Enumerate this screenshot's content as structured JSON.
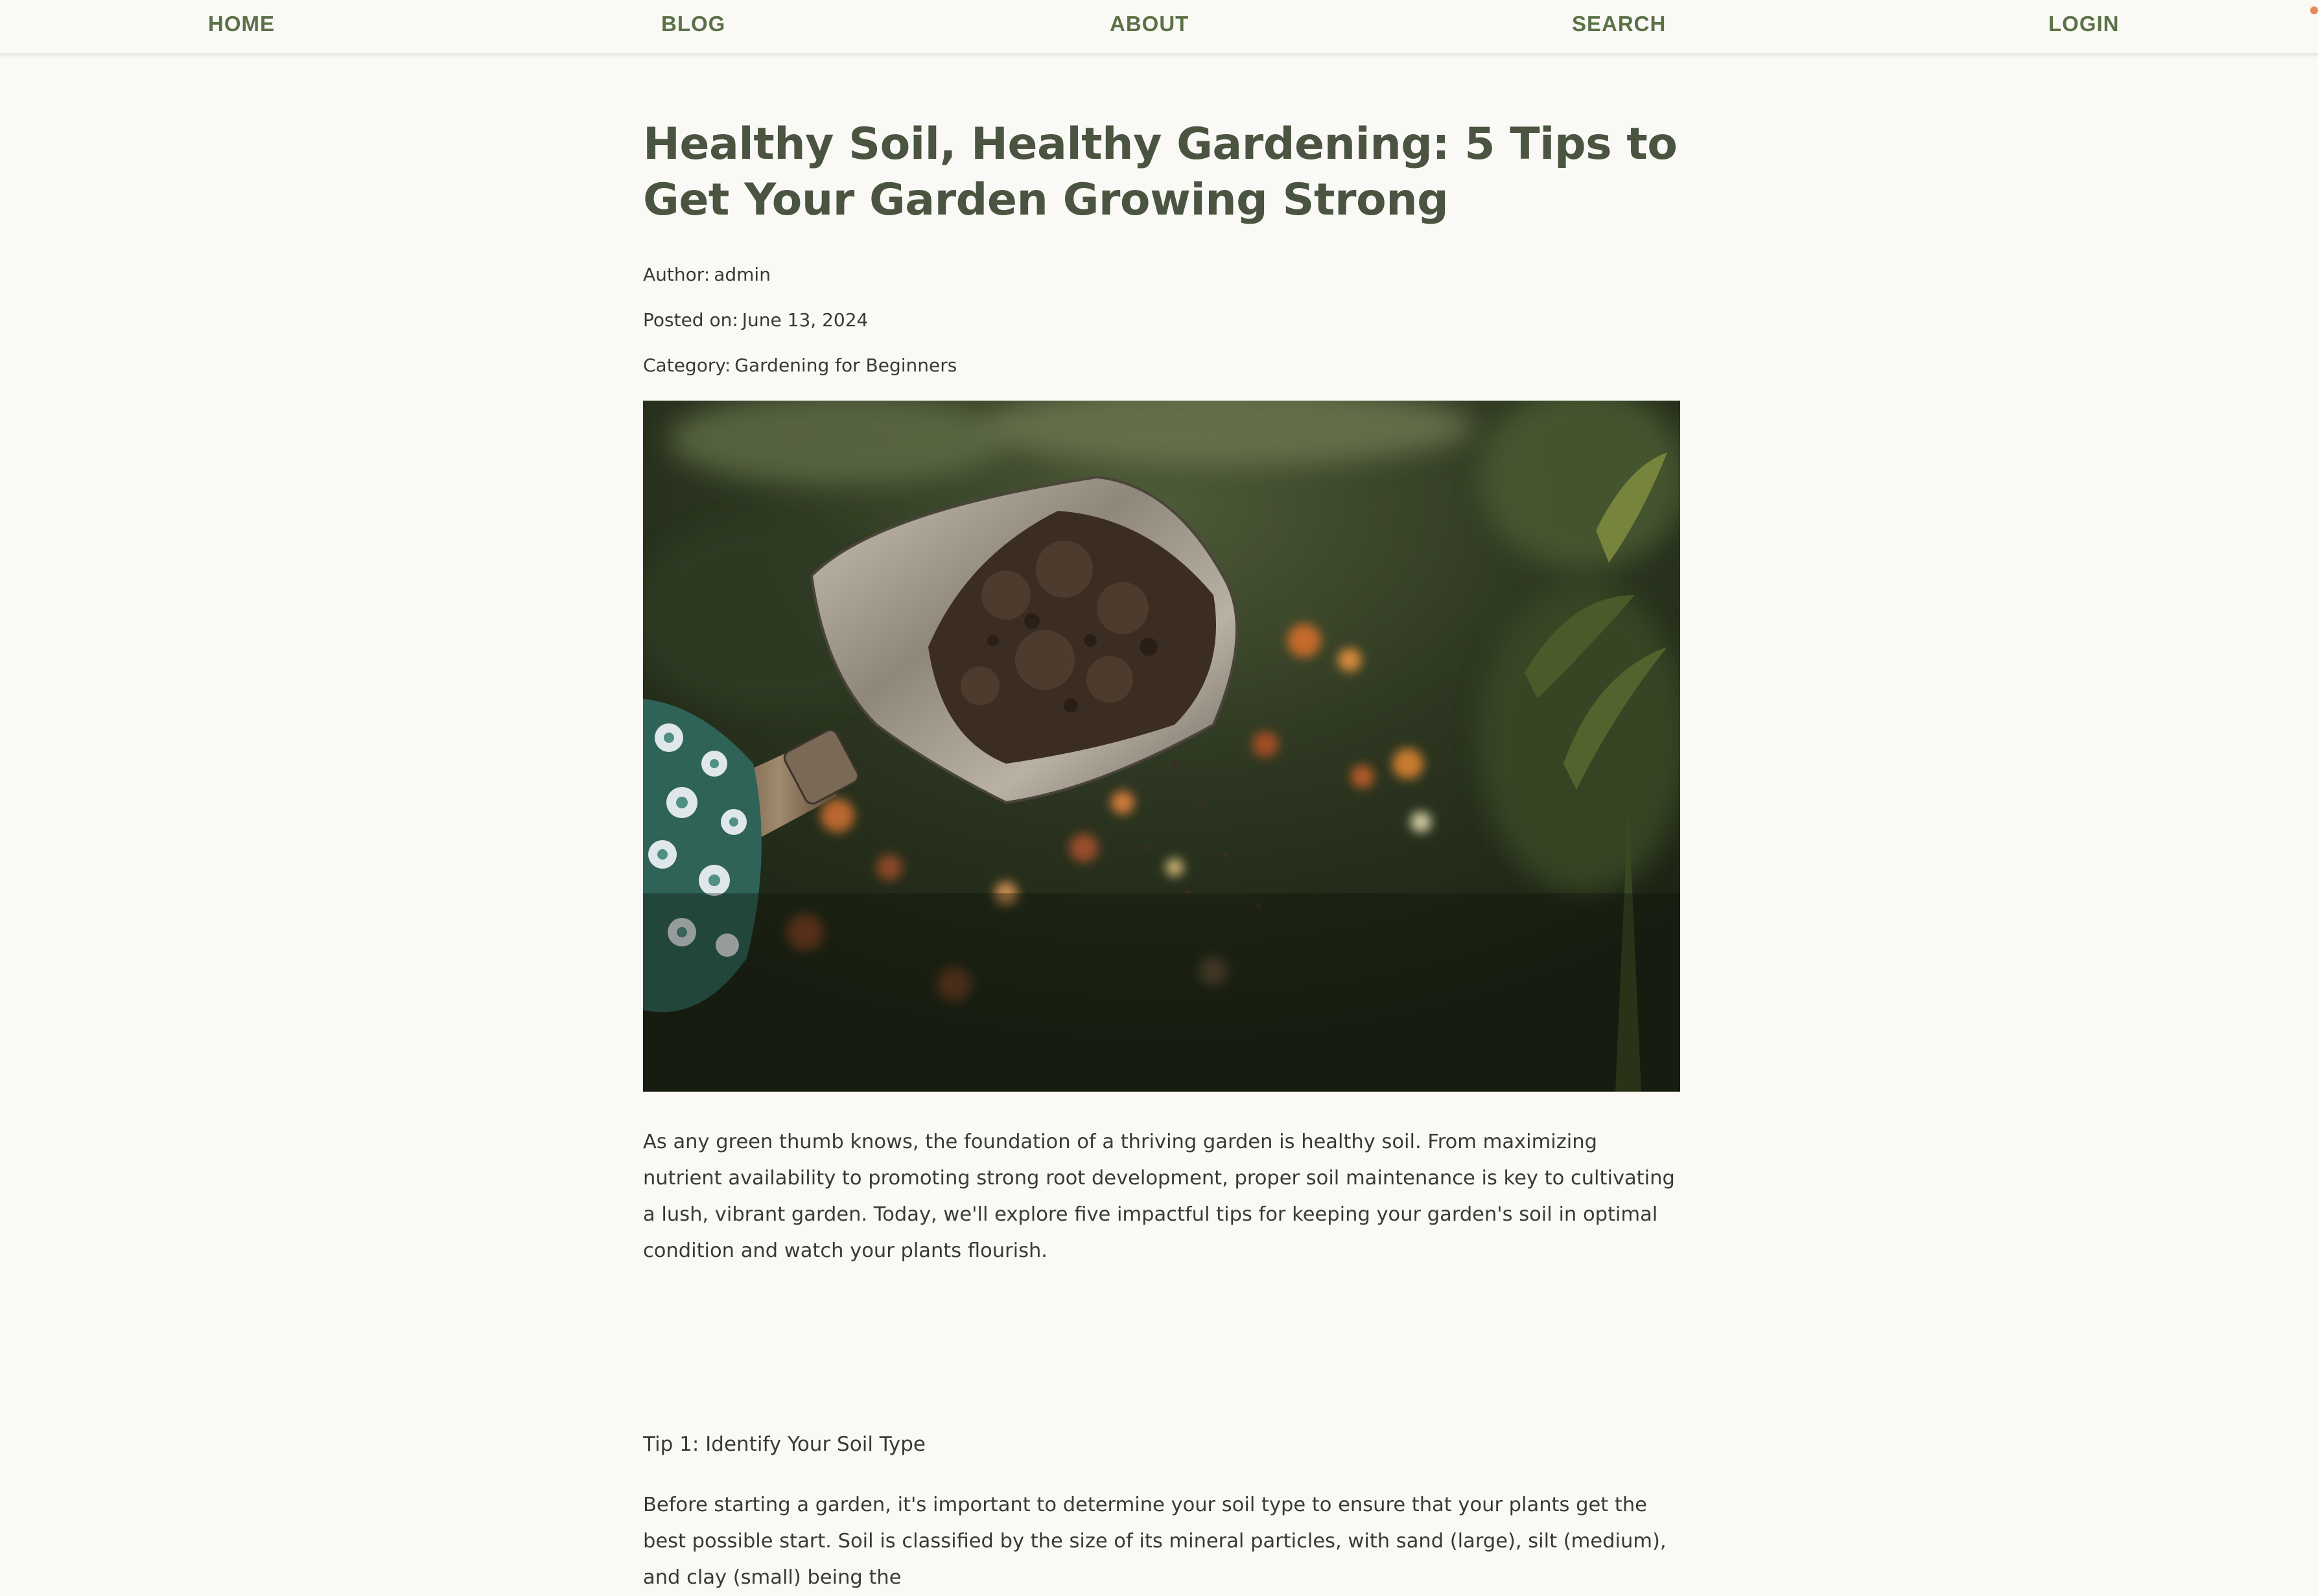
{
  "nav": {
    "home": "HOME",
    "blog": "BLOG",
    "about": "ABOUT",
    "search": "SEARCH",
    "login": "LOGIN"
  },
  "article": {
    "title": "Healthy Soil, Healthy Gardening: 5 Tips to Get Your Garden Growing Strong",
    "author_label": "Author:",
    "author": "admin",
    "posted_label": "Posted on:",
    "posted_date": "June 13, 2024",
    "category_label": "Category:",
    "category": "Gardening for Beginners",
    "intro": "As any green thumb knows, the foundation of a thriving garden is healthy soil. From maximizing nutrient availability to promoting strong root development, proper soil maintenance is key to cultivating a lush, vibrant garden. Today, we'll explore five impactful tips for keeping your garden's soil in optimal condition and watch your plants flourish.",
    "tip1_heading": "Tip 1: Identify Your Soil Type",
    "tip1_body": "Before starting a garden, it's important to determine your soil type to ensure that your plants get the best possible start. Soil is classified by the size of its mineral particles, with sand (large), silt (medium), and clay (small) being the"
  },
  "colors": {
    "nav": "#5b7146",
    "title": "#4a5440",
    "background": "#faf9f6",
    "text": "#3a3a34"
  }
}
